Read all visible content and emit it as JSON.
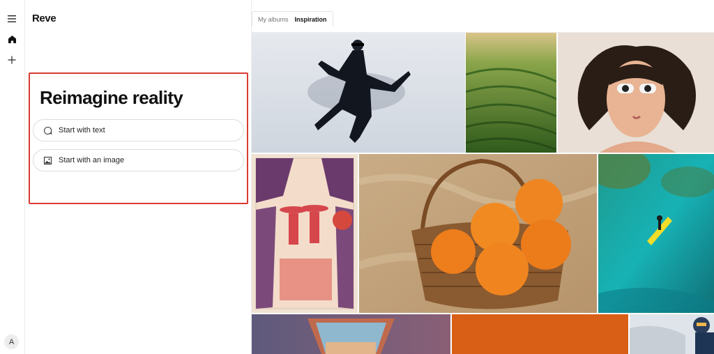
{
  "app": {
    "logo": "Reve"
  },
  "rail": {
    "icons": [
      "menu-icon",
      "home-icon",
      "plus-icon"
    ],
    "avatar_initial": "A"
  },
  "hero": {
    "headline": "Reimagine reality",
    "actions": [
      {
        "label": "Start with text",
        "icon": "chat-bubble-icon"
      },
      {
        "label": "Start with an image",
        "icon": "image-icon"
      }
    ]
  },
  "tabs": [
    {
      "label": "My albums",
      "active": false
    },
    {
      "label": "Inspiration",
      "active": true
    }
  ],
  "gallery": {
    "items": [
      "dancer-blindfold-image",
      "rice-terraces-image",
      "woman-star-sunglasses-image",
      "red-umbrella-poster-image",
      "oranges-basket-image",
      "paddleboard-ocean-image",
      "window-sky-image",
      "orange-block-image",
      "climber-snow-image"
    ],
    "colors": {
      "accent_highlight": "#d93a32",
      "orange_block": "#d85f15"
    }
  }
}
